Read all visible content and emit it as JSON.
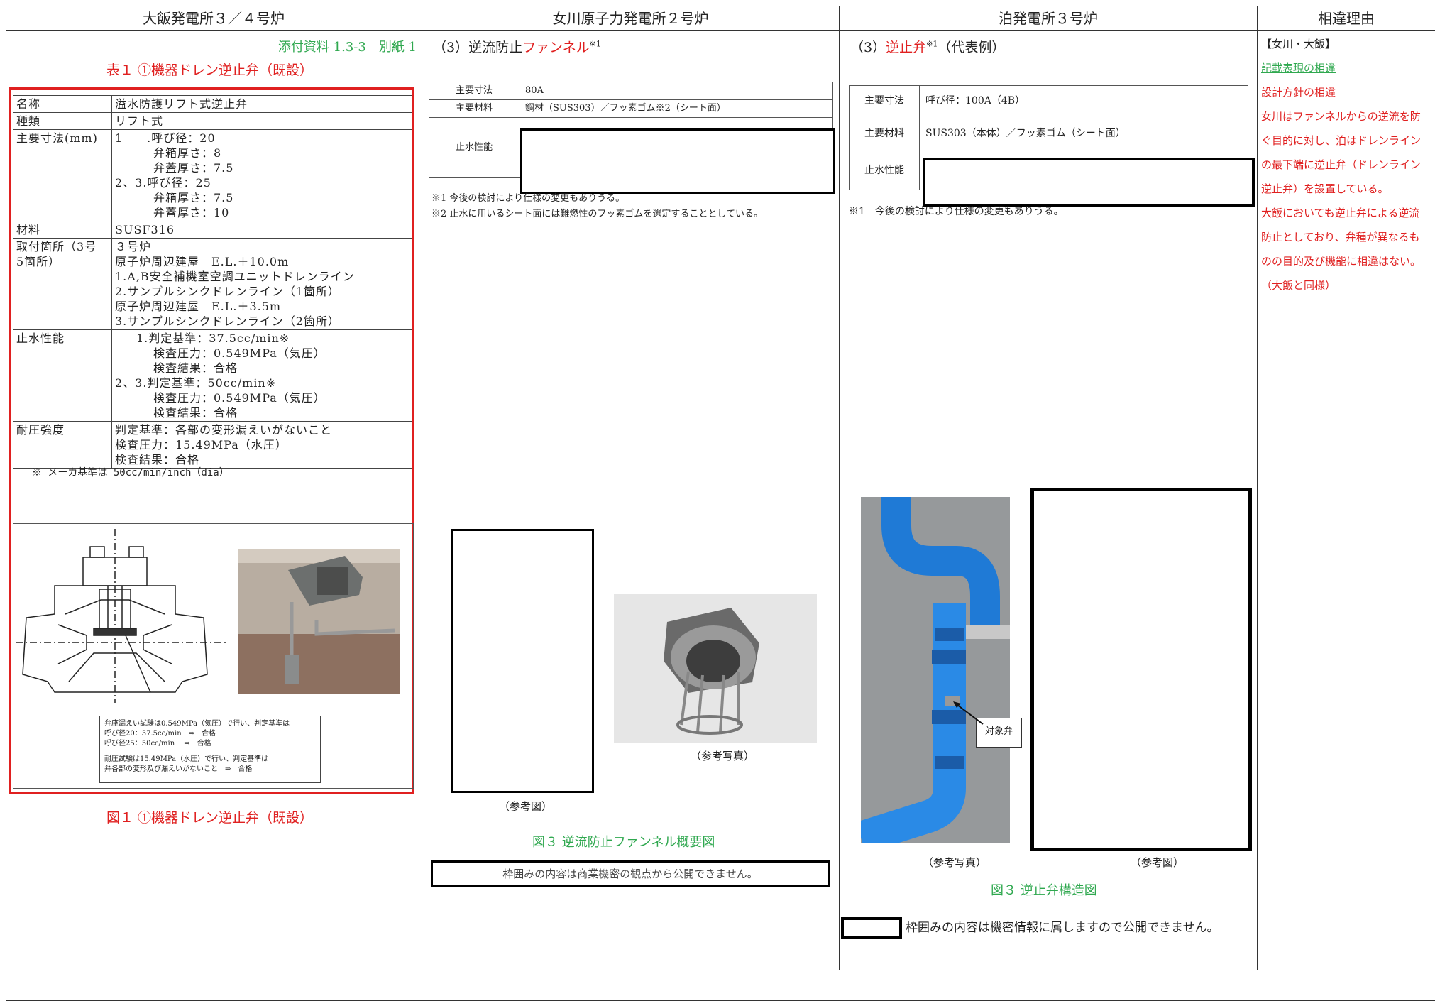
{
  "headers": {
    "col1": "大飯発電所３／４号炉",
    "col2": "女川原子力発電所２号炉",
    "col3": "泊発電所３号炉",
    "col4": "相違理由"
  },
  "col1": {
    "attachment": "添付資料 1.3-3　別紙 1",
    "table_title": "表１ ①機器ドレン逆止弁（既設）",
    "rows": [
      {
        "label": "名称",
        "value": [
          "溢水防護リフト式逆止弁"
        ]
      },
      {
        "label": "種類",
        "value": [
          "リフト式"
        ]
      },
      {
        "label": "主要寸法(mm)",
        "value": [
          "1　　.呼び径：20",
          "弁箱厚さ：8",
          "弁蓋厚さ：7.5",
          "2、3.呼び径：25",
          "弁箱厚さ：7.5",
          "弁蓋厚さ：10"
        ]
      },
      {
        "label": "材料",
        "value": [
          "SUSF316"
        ]
      },
      {
        "label": "取付箇所（3号 5箇所）",
        "value": [
          "３号炉",
          "原子炉周辺建屋　E.L.＋10.0m",
          "1.A,B安全補機室空調ユニットドレンライン",
          "2.サンプルシンクドレンライン（1箇所）",
          "原子炉周辺建屋　E.L.＋3.5m",
          "3.サンプルシンクドレンライン（2箇所）"
        ]
      },
      {
        "label": "止水性能",
        "value": [
          "1.判定基準：37.5cc/min※",
          "検査圧力：0.549MPa（気圧）",
          "検査結果：合格",
          "2、3.判定基準：50cc/min※",
          "検査圧力：0.549MPa（気圧）",
          "検査結果：合格"
        ]
      },
      {
        "label": "耐圧強度",
        "value": [
          "判定基準：各部の変形漏えいがないこと",
          "検査圧力：15.49MPa（水圧）",
          "検査結果：合格"
        ]
      }
    ],
    "footnote": "※ メーカ基準は 50cc/min/inch（dia）",
    "fig_notes": [
      "弁座漏えい試験は0.549MPa（気圧）で行い、判定基準は",
      "呼び径20：37.5cc/min　⇒　合格",
      "呼び径25：50cc/min　 ⇒　合格",
      "耐圧試験は15.49MPa（水圧）で行い、判定基準は",
      "弁各部の変形及び漏えいがないこと　⇒　合格"
    ],
    "fig_caption": "図１ ①機器ドレン逆止弁（既設）"
  },
  "col2": {
    "heading_prefix": "（3）逆流防止",
    "heading_red": "ファンネル",
    "heading_sup": "※1",
    "rows": [
      {
        "label": "主要寸法",
        "value": "80A"
      },
      {
        "label": "主要材料",
        "value": "鋼材（SUS303）／フッ素ゴム※2（シート面）"
      },
      {
        "label": "止水性能",
        "value": ""
      }
    ],
    "notes": [
      "※1 今後の検討により仕様の変更もありうる。",
      "※2 止水に用いるシート面には難燃性のフッ素ゴムを選定することとしている。"
    ],
    "ref_fig": "（参考図）",
    "ref_photo": "（参考写真）",
    "fig_caption": "図３ 逆流防止ファンネル概要図",
    "secret": "枠囲みの内容は商業機密の観点から公開できません。"
  },
  "col3": {
    "heading_prefix": "（3）",
    "heading_red": "逆止弁",
    "heading_sup": "※1",
    "heading_suffix": "（代表例）",
    "rows": [
      {
        "label": "主要寸法",
        "value": "呼び径：100A（4B）"
      },
      {
        "label": "主要材料",
        "value": "SUS303（本体）／フッ素ゴム（シート面）"
      },
      {
        "label": "止水性能",
        "value": ""
      }
    ],
    "note": "※1　今後の検討により仕様の変更もありうる。",
    "target_label": "対象弁",
    "ref_photo": "（参考写真）",
    "ref_fig": "（参考図）",
    "fig_caption": "図３ 逆止弁構造図",
    "secret": "枠囲みの内容は機密情報に属しますので公開できません。"
  },
  "col4": {
    "lines": [
      "【女川・大飯】",
      "記載表現の相違",
      "設計方針の相違",
      "女川はファンネルからの逆流を防",
      "ぐ目的に対し、泊はドレンライン",
      "の最下端に逆止弁（ドレンライン",
      "逆止弁）を設置している。",
      "大飯においても逆止弁による逆流",
      "防止としており、弁種が異なるも",
      "のの目的及び機能に相違はない。",
      "（大飯と同様）"
    ]
  },
  "colors": {
    "red": "#e02020",
    "green": "#2fa84f"
  }
}
